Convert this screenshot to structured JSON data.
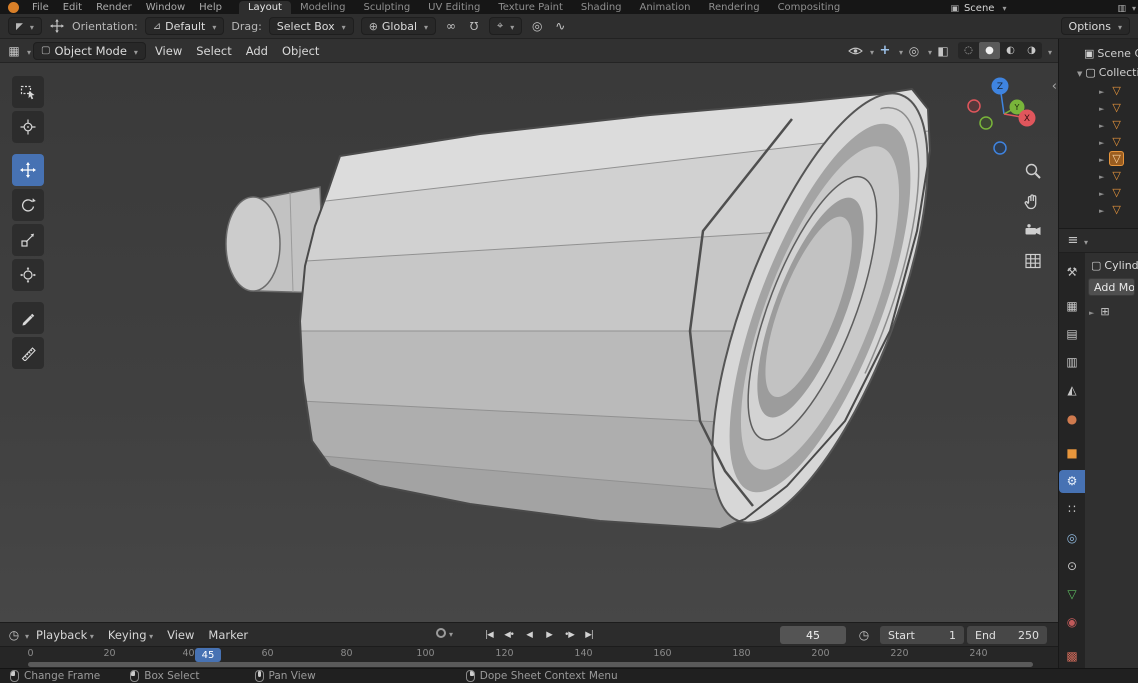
{
  "colors": {
    "accent": "#4772b3",
    "object_orange": "#e8963c",
    "viewport_bg": "#3d3d3d"
  },
  "topbar": {
    "menus": [
      "File",
      "Edit",
      "Render",
      "Window",
      "Help"
    ],
    "workspaces": [
      {
        "label": "Layout",
        "active": true
      },
      {
        "label": "Modeling"
      },
      {
        "label": "Sculpting"
      },
      {
        "label": "UV Editing"
      },
      {
        "label": "Texture Paint"
      },
      {
        "label": "Shading"
      },
      {
        "label": "Animation"
      },
      {
        "label": "Rendering"
      },
      {
        "label": "Compositing"
      }
    ],
    "scene_label": "Scene"
  },
  "tool_settings": {
    "orientation_label": "Orientation:",
    "orientation_value": "Default",
    "drag_label": "Drag:",
    "drag_value": "Select Box",
    "transform_space": "Global",
    "options_label": "Options"
  },
  "viewport": {
    "mode": "Object Mode",
    "menus": [
      "View",
      "Select",
      "Add",
      "Object"
    ],
    "shading_modes": [
      {
        "name": "shading-wireframe",
        "glyph": "◌"
      },
      {
        "name": "shading-solid",
        "glyph": "●",
        "active": true
      },
      {
        "name": "shading-material",
        "glyph": "◐"
      },
      {
        "name": "shading-rendered",
        "glyph": "◑"
      }
    ],
    "gizmo_axes": {
      "x": "X",
      "y": "Y",
      "z": "Z"
    },
    "tools": [
      {
        "name": "tool-select-box"
      },
      {
        "name": "tool-cursor"
      },
      {
        "name": "tool-move",
        "active": true
      },
      {
        "name": "tool-rotate"
      },
      {
        "name": "tool-scale"
      },
      {
        "name": "tool-transform"
      },
      {
        "name": "tool-annotate"
      },
      {
        "name": "tool-measure"
      }
    ]
  },
  "outliner": {
    "scene_collection_label": "Scene Collection",
    "collection_label": "Collection",
    "objects": [
      {
        "selected": false
      },
      {
        "selected": false
      },
      {
        "selected": false
      },
      {
        "selected": false
      },
      {
        "selected": true
      },
      {
        "selected": false
      },
      {
        "selected": false
      },
      {
        "selected": false
      }
    ]
  },
  "properties": {
    "object_name": "Cylinder",
    "add_modifier_label": "Add Modifier",
    "tabs": [
      {
        "name": "tab-tool",
        "glyph": "⚒",
        "color": "#c8c8c8"
      },
      {
        "name": "tab-render",
        "glyph": "▦",
        "color": "#c8c8c8",
        "gap": true
      },
      {
        "name": "tab-output",
        "glyph": "▤",
        "color": "#c8c8c8"
      },
      {
        "name": "tab-view-layer",
        "glyph": "▥",
        "color": "#c8c8c8"
      },
      {
        "name": "tab-scene",
        "glyph": "◭",
        "color": "#c8c8c8"
      },
      {
        "name": "tab-world",
        "glyph": "●",
        "color": "#cf7a4e"
      },
      {
        "name": "tab-object",
        "glyph": "■",
        "color": "#e8963c",
        "gap": true
      },
      {
        "name": "tab-modifiers",
        "glyph": "⚙",
        "color": "#eaf2fc",
        "active": true
      },
      {
        "name": "tab-particles",
        "glyph": "∷",
        "color": "#c8c8c8"
      },
      {
        "name": "tab-physics",
        "glyph": "◎",
        "color": "#8fb8dd"
      },
      {
        "name": "tab-constraints",
        "glyph": "⊙",
        "color": "#c8c8c8"
      },
      {
        "name": "tab-data",
        "glyph": "▽",
        "color": "#5cb85f"
      },
      {
        "name": "tab-material",
        "glyph": "◉",
        "color": "#c05a5a"
      },
      {
        "name": "tab-texture",
        "glyph": "▩",
        "color": "#cf6a5a",
        "gap": true
      }
    ]
  },
  "timeline": {
    "menus": [
      {
        "label": "Playback",
        "caret": true
      },
      {
        "label": "Keying",
        "caret": true
      },
      {
        "label": "View"
      },
      {
        "label": "Marker"
      }
    ],
    "transport": [
      {
        "name": "jump-to-start",
        "glyph": "|◀"
      },
      {
        "name": "prev-keyframe",
        "glyph": "◀•"
      },
      {
        "name": "play-reverse",
        "glyph": "◀"
      },
      {
        "name": "play",
        "glyph": "▶"
      },
      {
        "name": "next-keyframe",
        "glyph": "•▶"
      },
      {
        "name": "jump-to-end",
        "glyph": "▶|"
      }
    ],
    "current_frame": "45",
    "start_label": "Start",
    "start_value": "1",
    "end_label": "End",
    "end_value": "250",
    "ticks": [
      "0",
      "20",
      "40",
      "60",
      "80",
      "100",
      "120",
      "140",
      "160",
      "180",
      "200",
      "220",
      "240"
    ]
  },
  "statusbar": {
    "items": [
      {
        "button": "lmb",
        "label": "Change Frame"
      },
      {
        "button": "lmb",
        "label": "Box Select"
      },
      {
        "button": "mmb",
        "label": "Pan View"
      },
      {
        "button": "rmb",
        "label": "Dope Sheet Context Menu"
      }
    ]
  }
}
